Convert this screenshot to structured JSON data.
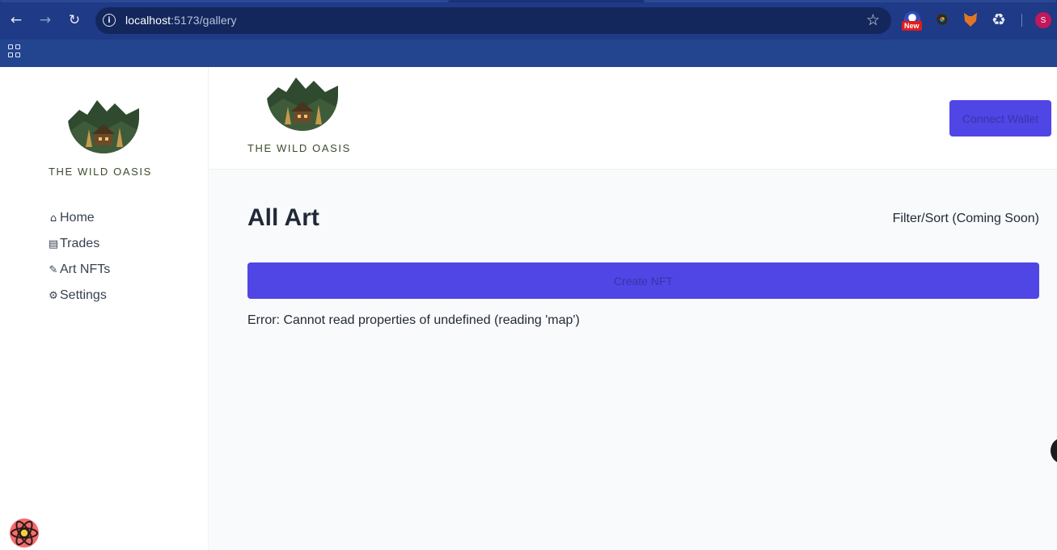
{
  "browser": {
    "url_host": "localhost",
    "url_path": ":5173/gallery",
    "new_badge": "New",
    "profile_initial": "S",
    "icons": [
      "back-arrow-icon",
      "forward-arrow-icon",
      "reload-icon",
      "site-info-icon",
      "bookmark-star-icon",
      "extensions-puzzle-icon",
      "apps-grid-icon"
    ]
  },
  "sidebar": {
    "logo_text": "THE WILD OASIS",
    "items": [
      {
        "label": "Home",
        "icon": "home-icon"
      },
      {
        "label": "Trades",
        "icon": "cash-icon"
      },
      {
        "label": "Art NFTs",
        "icon": "brush-icon"
      },
      {
        "label": "Settings",
        "icon": "gear-icon"
      }
    ]
  },
  "header": {
    "logo_text": "THE WILD OASIS",
    "connect_wallet_label": "Connect Wallet"
  },
  "main": {
    "title": "All Art",
    "filter_label": "Filter/Sort (Coming Soon)",
    "create_nft_label": "Create NFT",
    "error_message": "Error: Cannot read properties of undefined (reading 'map')"
  },
  "colors": {
    "accent": "#4f46e5",
    "chrome": "#1f3a86",
    "text": "#1f2937"
  }
}
